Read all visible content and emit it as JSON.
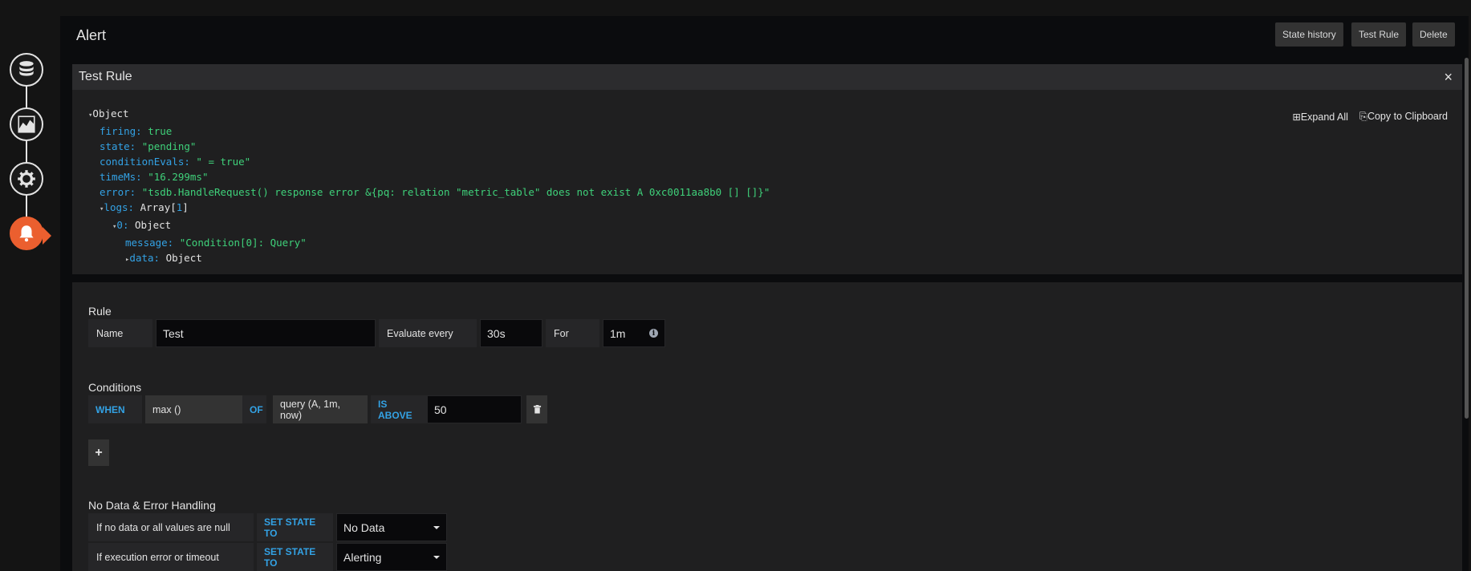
{
  "header": {
    "title": "Alert",
    "buttons": {
      "state_history": "State history",
      "test_rule": "Test Rule",
      "delete": "Delete"
    }
  },
  "steps": [
    {
      "icon": "database-icon"
    },
    {
      "icon": "graph-icon"
    },
    {
      "icon": "gear-icon"
    },
    {
      "icon": "bell-icon",
      "active": true
    }
  ],
  "colors": {
    "active_step": "#eb5f2f",
    "keyword": "#33a2e5",
    "string": "#3fd17a"
  },
  "test_rule": {
    "title": "Test Rule",
    "close": "×",
    "expand_all": "Expand All",
    "copy": "Copy to Clipboard",
    "tree": {
      "root": "Object",
      "firing_key": "firing:",
      "firing_val": "true",
      "state_key": "state:",
      "state_val": "\"pending\"",
      "cond_key": "conditionEvals:",
      "cond_val": "\" = true\"",
      "time_key": "timeMs:",
      "time_val": "\"16.299ms\"",
      "error_key": "error:",
      "error_val": "\"tsdb.HandleRequest() response error &{pq: relation \"metric_table\" does not exist A 0xc0011aa8b0 [] []}\"",
      "logs_key": "logs:",
      "logs_type": "Array",
      "logs_count": "1",
      "log0_key": "0:",
      "log0_val": "Object",
      "msg_key": "message:",
      "msg_val": "\"Condition[0]: Query\"",
      "data_key": "data:",
      "data_val": "Object"
    }
  },
  "rule": {
    "section": "Rule",
    "name_label": "Name",
    "name_value": "Test",
    "evaluate_label": "Evaluate every",
    "evaluate_value": "30s",
    "for_label": "For",
    "for_value": "1m"
  },
  "conditions": {
    "section": "Conditions",
    "when": "WHEN",
    "reducer": "max ()",
    "of": "OF",
    "query": "query (A, 1m, now)",
    "evaluator": "IS ABOVE",
    "threshold": "50",
    "add": "+"
  },
  "nodata": {
    "section": "No Data & Error Handling",
    "row1_label": "If no data or all values are null",
    "row1_kw": "SET STATE TO",
    "row1_value": "No Data",
    "row2_label": "If execution error or timeout",
    "row2_kw": "SET STATE TO",
    "row2_value": "Alerting"
  }
}
